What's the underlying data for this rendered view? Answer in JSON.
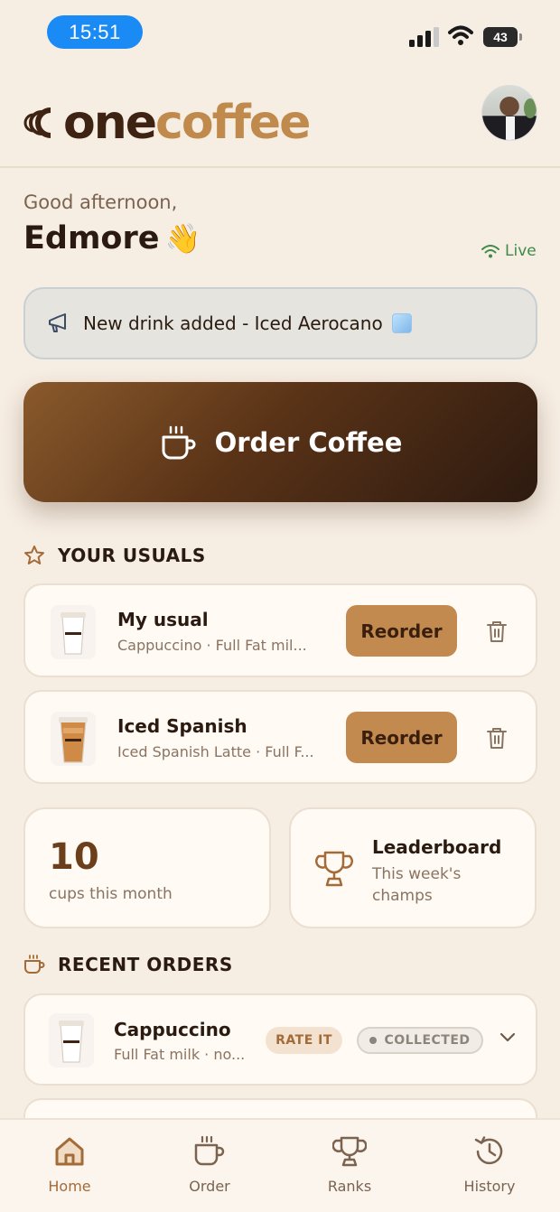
{
  "status_bar": {
    "time": "15:51",
    "battery": "43"
  },
  "header": {
    "logo_one": "one",
    "logo_coffee": "coffee"
  },
  "greeting": {
    "salutation": "Good afternoon,",
    "name": "Edmore",
    "emoji": "👋",
    "live_label": "Live"
  },
  "announcement": {
    "text": "New drink added - Iced Aerocano"
  },
  "order_button": {
    "label": "Order Coffee"
  },
  "usuals": {
    "title": "YOUR USUALS",
    "items": [
      {
        "name": "My usual",
        "detail": "Cappuccino · Full Fat mil...",
        "action": "Reorder",
        "cup": "hot"
      },
      {
        "name": "Iced Spanish",
        "detail": "Iced Spanish Latte · Full F...",
        "action": "Reorder",
        "cup": "iced"
      }
    ]
  },
  "stats": {
    "cups_count": "10",
    "cups_label": "cups this month",
    "leaderboard_title": "Leaderboard",
    "leaderboard_sub": "This week's champs"
  },
  "recent_orders": {
    "title": "RECENT ORDERS",
    "items": [
      {
        "name": "Cappuccino",
        "detail": "Full Fat milk · no...",
        "rate_label": "RATE IT",
        "status": "COLLECTED"
      }
    ]
  },
  "nav": {
    "items": [
      {
        "label": "Home",
        "active": true
      },
      {
        "label": "Order",
        "active": false
      },
      {
        "label": "Ranks",
        "active": false
      },
      {
        "label": "History",
        "active": false
      }
    ]
  },
  "colors": {
    "accent": "#c38a4f",
    "brand_dark": "#3e2212",
    "background": "#f6ede3",
    "live": "#3f8a4a"
  }
}
